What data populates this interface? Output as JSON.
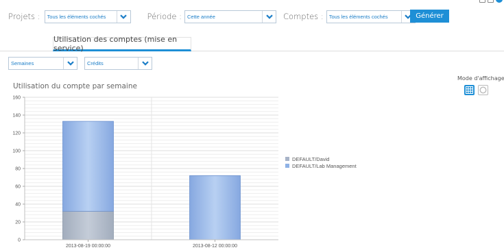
{
  "filters": {
    "projets_label": "Projets :",
    "projets_value": "Tous les éléments cochés",
    "periode_label": "Période :",
    "periode_value": "Cette année",
    "comptes_label": "Comptes :",
    "comptes_value": "Tous les éléments cochés",
    "generate_label": "Générer"
  },
  "tabs": [
    {
      "label": "Utilisation des comptes (mise en service)",
      "active": true
    }
  ],
  "subfilters": {
    "interval_value": "Semaines",
    "metric_value": "Crédits"
  },
  "chart": {
    "title": "Utilisation du compte par semaine"
  },
  "display_mode": {
    "label": "Mode d'affichage",
    "options": [
      "grid-icon",
      "pie-icon"
    ],
    "selected": "grid-icon"
  },
  "colors": {
    "accent": "#1e8fd6",
    "series_david": "#a8b4c8",
    "series_lab": "#8fb2e6"
  },
  "chart_data": {
    "type": "bar",
    "stacked": true,
    "title": "Utilisation du compte par semaine",
    "categories": [
      "2013-08-19 00:00:00",
      "2013-08-12 00:00:00"
    ],
    "series": [
      {
        "name": "DEFAULT/David",
        "values": [
          32,
          0
        ]
      },
      {
        "name": "DEFAULT/Lab Management",
        "values": [
          101,
          72
        ]
      }
    ],
    "ylim": [
      0,
      160
    ],
    "yticks": [
      0,
      20,
      40,
      60,
      80,
      100,
      120,
      140,
      160
    ],
    "grid": true,
    "legend": "right"
  }
}
